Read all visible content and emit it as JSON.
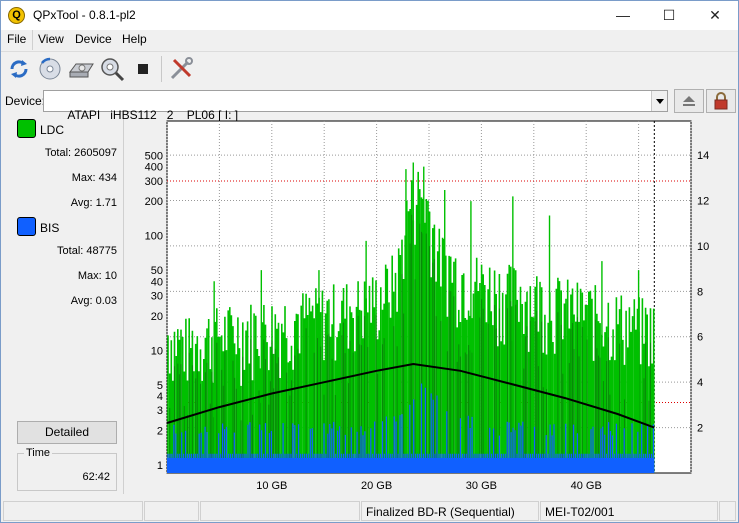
{
  "window": {
    "title": "QPxTool - 0.8.1-pl2",
    "app_icon_glyph": "Q",
    "minimize_glyph": "—",
    "maximize_glyph": "☐",
    "close_glyph": "✕"
  },
  "menu": [
    "File",
    "View",
    "Device",
    "Help"
  ],
  "toolbar": {
    "icons": [
      "refresh-icon",
      "disc-scan-icon",
      "drive-icon",
      "zoom-scan-icon",
      "stop-icon",
      "tools-icon"
    ]
  },
  "device": {
    "label": "Device:",
    "value": "ATAPI   iHBS112   2    PL06 [ I: ]"
  },
  "left": {
    "ldc": {
      "name": "LDC",
      "color": "#00c000",
      "total_label": "Total:",
      "total": "2605097",
      "max_label": "Max:",
      "max": "434",
      "avg_label": "Avg:",
      "avg": "1.71"
    },
    "bis": {
      "name": "BIS",
      "color": "#1060ff",
      "total_label": "Total:",
      "total": "48775",
      "max_label": "Max:",
      "max": "10",
      "avg_label": "Avg:",
      "avg": "0.03"
    },
    "detailed_button": "Detailed",
    "time_label": "Time",
    "time_value": "62:42"
  },
  "chart_data": {
    "type": "area",
    "x_ticks": [
      "10 GB",
      "20 GB",
      "30 GB",
      "40 GB"
    ],
    "x_tick_values": [
      10,
      20,
      30,
      40
    ],
    "xlim": [
      0,
      50
    ],
    "x_data_end": 46.5,
    "y_left_scale": "log",
    "y_left_ticks": [
      "1",
      "2",
      "3",
      "4",
      "5",
      "10",
      "20",
      "30",
      "40",
      "50",
      "100",
      "200",
      "300",
      "400",
      "500"
    ],
    "y_left_tick_values": [
      1,
      2,
      3,
      4,
      5,
      10,
      20,
      30,
      40,
      50,
      100,
      200,
      300,
      400,
      500
    ],
    "ylim_left": [
      0.85,
      1000
    ],
    "y_right_ticks": [
      "2",
      "4",
      "6",
      "8",
      "10",
      "12",
      "14"
    ],
    "y_right_tick_values": [
      2,
      4,
      6,
      8,
      10,
      12,
      14
    ],
    "ylim_right": [
      0,
      15.5
    ],
    "red_threshold_left": 300,
    "red_threshold_left_low": 3.5,
    "series": [
      {
        "name": "LDC",
        "color": "#00c000",
        "x": [
          0,
          2,
          4,
          6,
          8,
          10,
          12,
          14,
          16,
          18,
          20,
          22,
          23,
          24,
          25,
          26,
          28,
          30,
          32,
          34,
          36,
          38,
          40,
          42,
          44,
          46.5
        ],
        "y": [
          12,
          10,
          12,
          13,
          14,
          15,
          17,
          18,
          20,
          22,
          25,
          40,
          150,
          220,
          150,
          60,
          40,
          35,
          30,
          28,
          25,
          22,
          20,
          18,
          16,
          14
        ]
      },
      {
        "name": "LDC peaks",
        "color": "#00c000",
        "x": [
          4.5,
          9,
          14.5,
          19,
          22.8,
          23.5,
          24.5,
          26.5,
          29,
          33,
          36.5,
          41.5,
          45
        ],
        "y": [
          40,
          50,
          50,
          90,
          380,
          434,
          400,
          250,
          200,
          220,
          150,
          60,
          50
        ]
      },
      {
        "name": "BIS",
        "color": "#1060ff",
        "x": [
          0,
          10,
          20,
          23,
          24,
          25,
          30,
          40,
          46.5
        ],
        "y": [
          2,
          2,
          2,
          3,
          5,
          4,
          2,
          2,
          2
        ]
      },
      {
        "name": "speed",
        "color": "#000000",
        "x": [
          0,
          5,
          10,
          15,
          20,
          23.5,
          28,
          33,
          38,
          43,
          46.5
        ],
        "y": [
          2.2,
          2.9,
          3.5,
          4.0,
          4.5,
          4.8,
          4.5,
          3.9,
          3.3,
          2.6,
          2.0
        ]
      }
    ]
  },
  "status": {
    "cells": [
      "",
      "",
      "",
      "Finalized BD-R (Sequential)",
      "MEI-T02/001",
      ""
    ]
  }
}
